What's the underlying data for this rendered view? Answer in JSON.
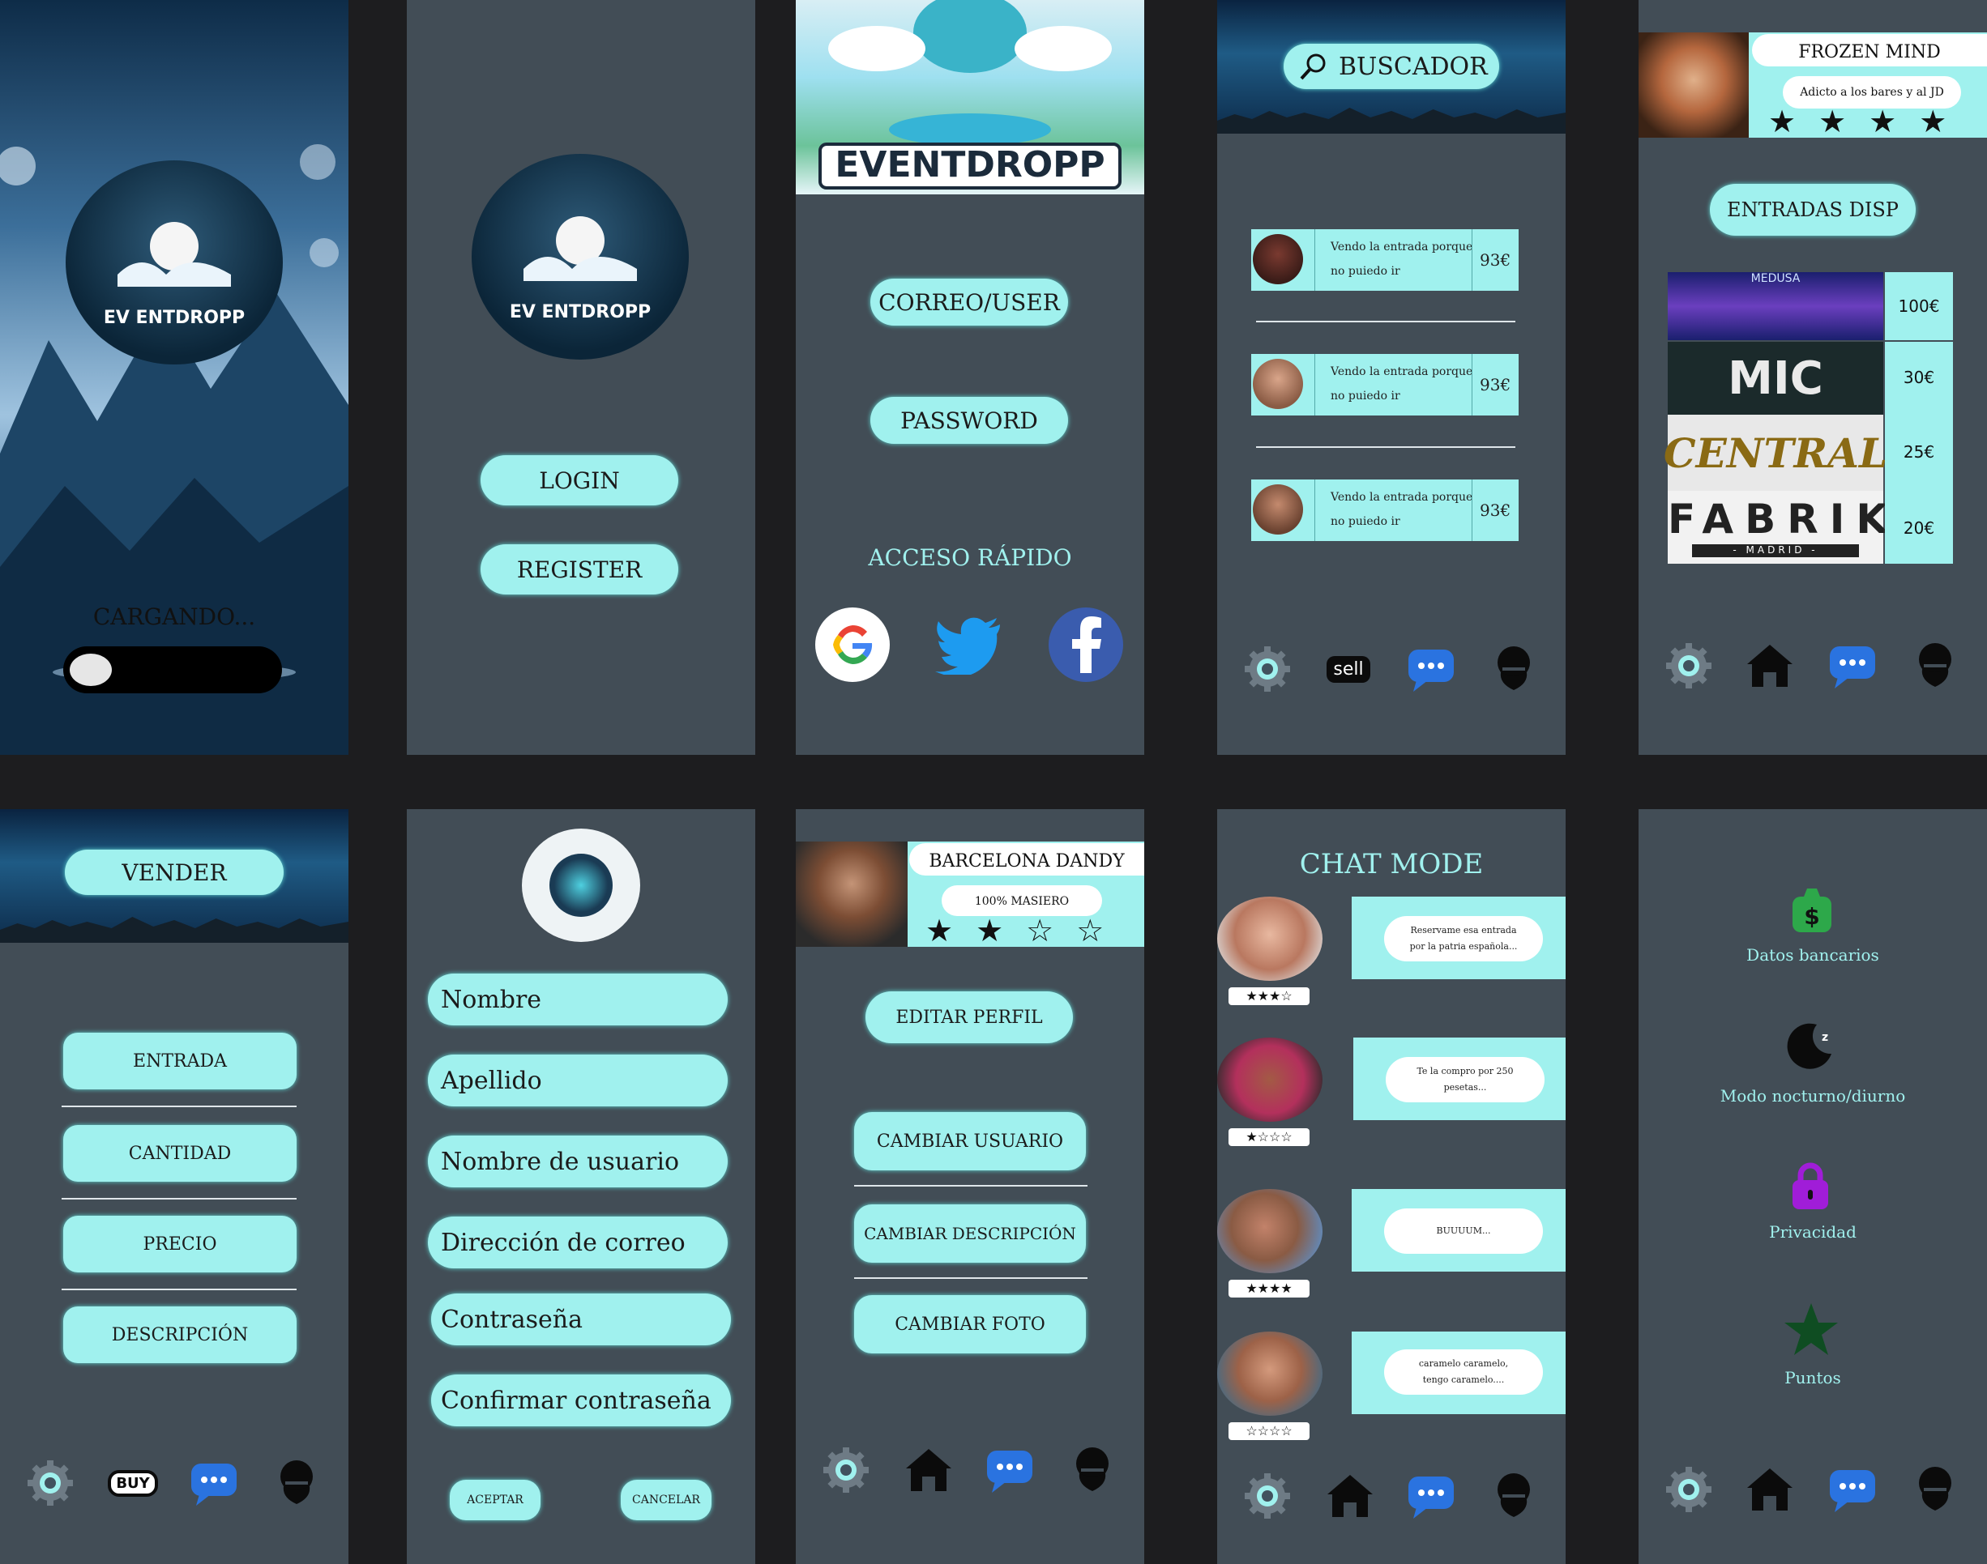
{
  "splash": {
    "loading": "CARGANDO...",
    "logo_text": "EV ENTDROPP"
  },
  "welcome": {
    "logo_text": "EV ENTDROPP",
    "login": "LOGIN",
    "register": "REGISTER"
  },
  "login": {
    "brand": "EVENTDROPP",
    "user_field": "CORREO/USER",
    "password_field": "PASSWORD",
    "quick_access": "ACCESO RÁPIDO"
  },
  "search": {
    "title": "BUSCADOR",
    "listings": [
      {
        "line1": "Vendo la entrada porque",
        "line2": "no puiedo ir",
        "price": "93€"
      },
      {
        "line1": "Vendo la entrada porque",
        "line2": "no puiedo ir",
        "price": "93€"
      },
      {
        "line1": "Vendo la entrada porque",
        "line2": "no puiedo ir",
        "price": "93€"
      }
    ],
    "sell_badge": "sell"
  },
  "seller_profile": {
    "name": "FROZEN MIND",
    "bio": "Adicto a los bares y al JD",
    "rating": 4,
    "tickets_title": "ENTRADAS DISP",
    "tickets": [
      {
        "venue": "MEDUSA",
        "price": "100€"
      },
      {
        "venue": "MIC",
        "price": "30€"
      },
      {
        "venue": "CENTRAL",
        "price": "25€"
      },
      {
        "venue": "FABRIK",
        "subtitle": "- MADRID -",
        "price": "20€"
      }
    ]
  },
  "sell": {
    "title": "VENDER",
    "fields": [
      "ENTRADA",
      "CANTIDAD",
      "PRECIO",
      "DESCRIPCIÓN"
    ],
    "buy_badge": "BUY"
  },
  "register": {
    "fields": [
      "Nombre",
      "Apellido",
      "Nombre de usuario",
      "Dirección de correo",
      "Contraseña",
      "Confirmar contraseña"
    ],
    "accept": "ACEPTAR",
    "cancel": "CANCELAR"
  },
  "my_profile": {
    "name": "BARCELONA DANDY",
    "bio": "100% MASIERO",
    "rating": 2,
    "edit": "EDITAR PERFIL",
    "change_user": "CAMBIAR USUARIO",
    "change_desc": "CAMBIAR DESCRIPCIÓN",
    "change_photo": "CAMBIAR FOTO"
  },
  "chat": {
    "title": "CHAT MODE",
    "messages": [
      {
        "line1": "Reservame esa entrada",
        "line2": "por la patria española...",
        "rating": 3
      },
      {
        "line1": "Te la compro por 250",
        "line2": "pesetas...",
        "rating": 1
      },
      {
        "line1": "BUUUUM...",
        "line2": "",
        "rating": 4
      },
      {
        "line1": "caramelo caramelo,",
        "line2": "tengo caramelo....",
        "rating": 0
      }
    ]
  },
  "settings": {
    "items": [
      "Datos bancarios",
      "Modo nocturno/diurno",
      "Privacidad",
      "Puntos"
    ]
  },
  "colors": {
    "accent": "#a0f1ee",
    "screen_bg": "#424d56",
    "page_bg": "#1d1d1f",
    "chat_icon": "#2a73e0"
  }
}
